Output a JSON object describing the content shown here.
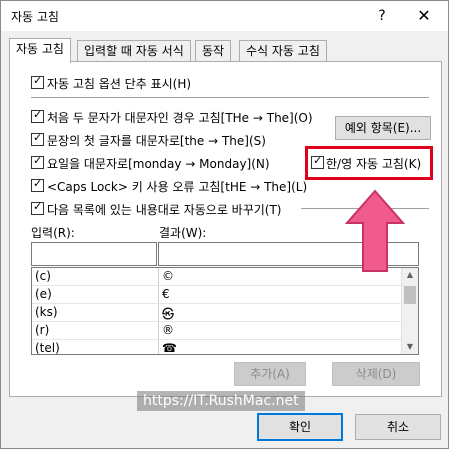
{
  "window": {
    "title": "자동 고침",
    "help_glyph": "?",
    "close_glyph": "✕"
  },
  "tabs": [
    "자동 고침",
    "입력할 때 자동 서식",
    "동작",
    "수식 자동 고침"
  ],
  "options": {
    "show_buttons": "자동 고침 옵션 단추 표시(H)",
    "two_initial_caps": "처음 두 문자가 대문자인 경우 고침[THe → The](O)",
    "first_letter_sentence": "문장의 첫 글자를 대문자로[the → The](S)",
    "weekday_caps": "요일을 대문자로[monday → Monday](N)",
    "caps_lock": "<Caps Lock> 키 사용 오류 고침[tHE → The](L)",
    "replace_text": "다음 목록에 있는 내용대로 자동으로 바꾸기(T)",
    "hanyoung": "한/영 자동 고침(K)"
  },
  "buttons": {
    "exceptions": "예외 항목(E)...",
    "add": "추가(A)",
    "delete": "삭제(D)",
    "ok": "확인",
    "cancel": "취소"
  },
  "fields": {
    "input_label": "입력(R):",
    "result_label": "결과(W):",
    "input_value": "",
    "result_value": ""
  },
  "replace_list": [
    {
      "from": "(c)",
      "to": "©"
    },
    {
      "from": "(e)",
      "to": "€"
    },
    {
      "from": "(ks)",
      "to": "㉿"
    },
    {
      "from": "(r)",
      "to": "®"
    },
    {
      "from": "(tel)",
      "to": "☎"
    }
  ],
  "watermark": "https://IT.RushMac.net",
  "colors": {
    "highlight": "#e0001b",
    "arrow": "#f05a8c",
    "focus": "#0078d7"
  }
}
